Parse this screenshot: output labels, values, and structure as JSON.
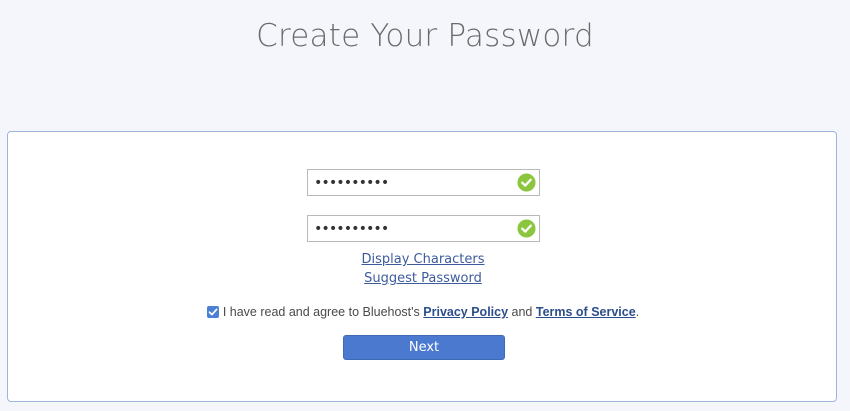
{
  "page": {
    "title": "Create Your Password"
  },
  "form": {
    "password_value": "••••••••••",
    "confirm_password_value": "••••••••••",
    "display_characters_label": "Display Characters",
    "suggest_password_label": "Suggest Password",
    "agree_checked": true,
    "agree_text_prefix": "I have read and agree to Bluehost's ",
    "privacy_policy_label": "Privacy Policy",
    "agree_text_and": " and ",
    "terms_label": "Terms of Service",
    "agree_text_suffix": ".",
    "next_label": "Next"
  },
  "icons": {
    "valid": "check-circle-icon",
    "checkbox": "checkmark-icon"
  },
  "colors": {
    "accent": "#4a79cf",
    "valid_green": "#8cc63f",
    "link": "#3d5b9c"
  }
}
